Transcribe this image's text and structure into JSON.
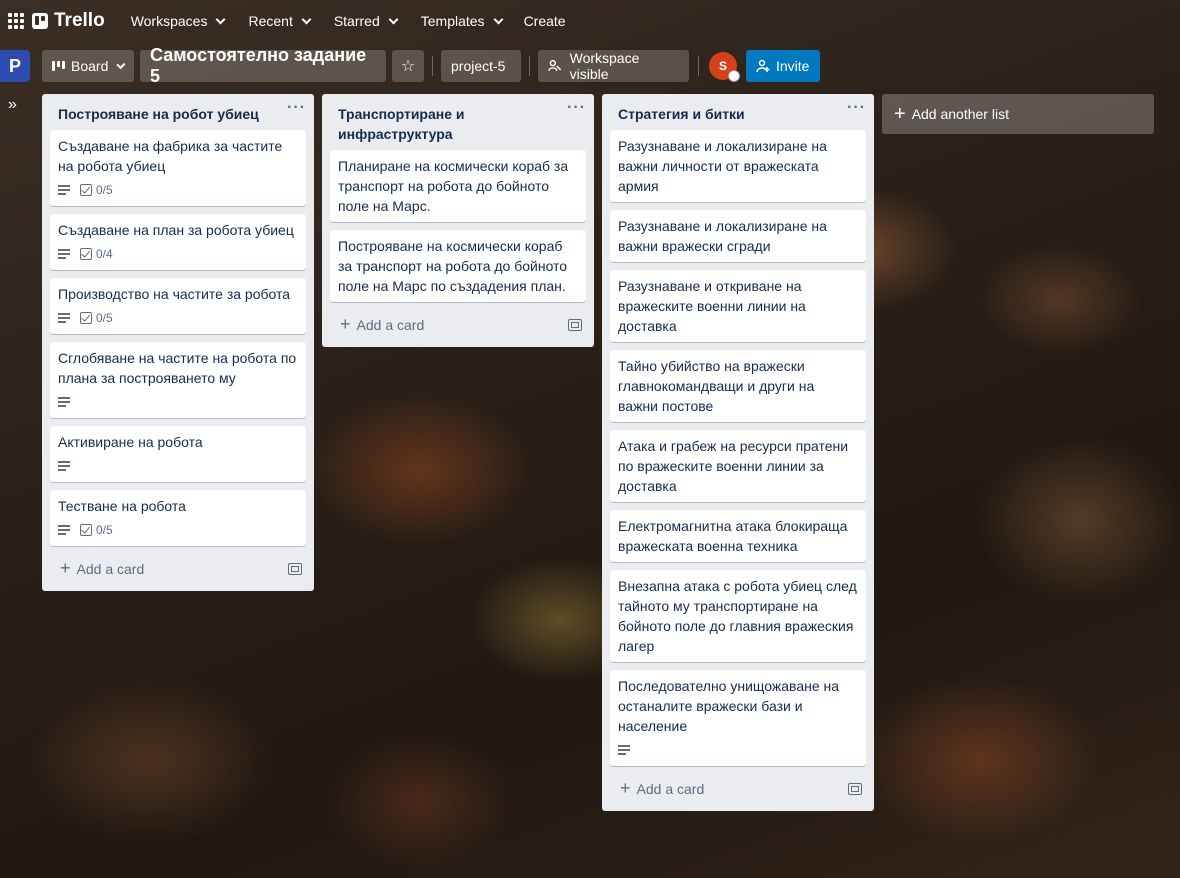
{
  "nav": {
    "logo": "Trello",
    "items": [
      {
        "label": "Workspaces"
      },
      {
        "label": "Recent"
      },
      {
        "label": "Starred"
      },
      {
        "label": "Templates"
      }
    ],
    "create": "Create"
  },
  "board": {
    "workspace_initial": "P",
    "view_label": "Board",
    "title": "Самостоятелно задание 5",
    "project_label": "project-5",
    "visibility_label": "Workspace visible",
    "avatar_initial": "S",
    "invite_label": "Invite"
  },
  "lists": [
    {
      "title": "Построяване на робот убиец",
      "add_card": "Add a card",
      "cards": [
        {
          "title": "Създаване на фабрика за частите на робота убиец",
          "checklist": "0/5"
        },
        {
          "title": "Създаване на план за робота убиец",
          "checklist": "0/4"
        },
        {
          "title": "Производство на частите за робота",
          "checklist": "0/5"
        },
        {
          "title": "Сглобяване на частите на робота по плана за построяването му"
        },
        {
          "title": "Активиране на робота"
        },
        {
          "title": "Тестване на робота",
          "checklist": "0/5"
        }
      ]
    },
    {
      "title": "Транспортиране и инфраструктура",
      "add_card": "Add a card",
      "cards": [
        {
          "title": "Планиране на космически кораб за транспорт на робота до бойното поле на Марс."
        },
        {
          "title": "Построяване на космически кораб за транспорт на робота до бойното поле на Марс по създадения план."
        }
      ]
    },
    {
      "title": "Стратегия и битки",
      "add_card": "Add a card",
      "cards": [
        {
          "title": "Разузнаване и локализиране на важни личности от вражеската армия"
        },
        {
          "title": "Разузнаване и локализиране на важни вражески сгради"
        },
        {
          "title": "Разузнаване и откриване на вражеските военни линии на доставка"
        },
        {
          "title": "Тайно убийство на вражески главнокомандващи и други на важни постове"
        },
        {
          "title": "Атака и грабеж на ресурси пратени по вражеските военни линии за доставка"
        },
        {
          "title": "Електромагнитна атака блокираща вражеската военна техника"
        },
        {
          "title": "Внезапна атака с робота убиец след тайното му транспортиране на бойното поле до главния вражеския лагер"
        },
        {
          "title": "Последователно унищожаване на останалите вражески бази и население"
        }
      ]
    }
  ],
  "add_list": "Add another list"
}
